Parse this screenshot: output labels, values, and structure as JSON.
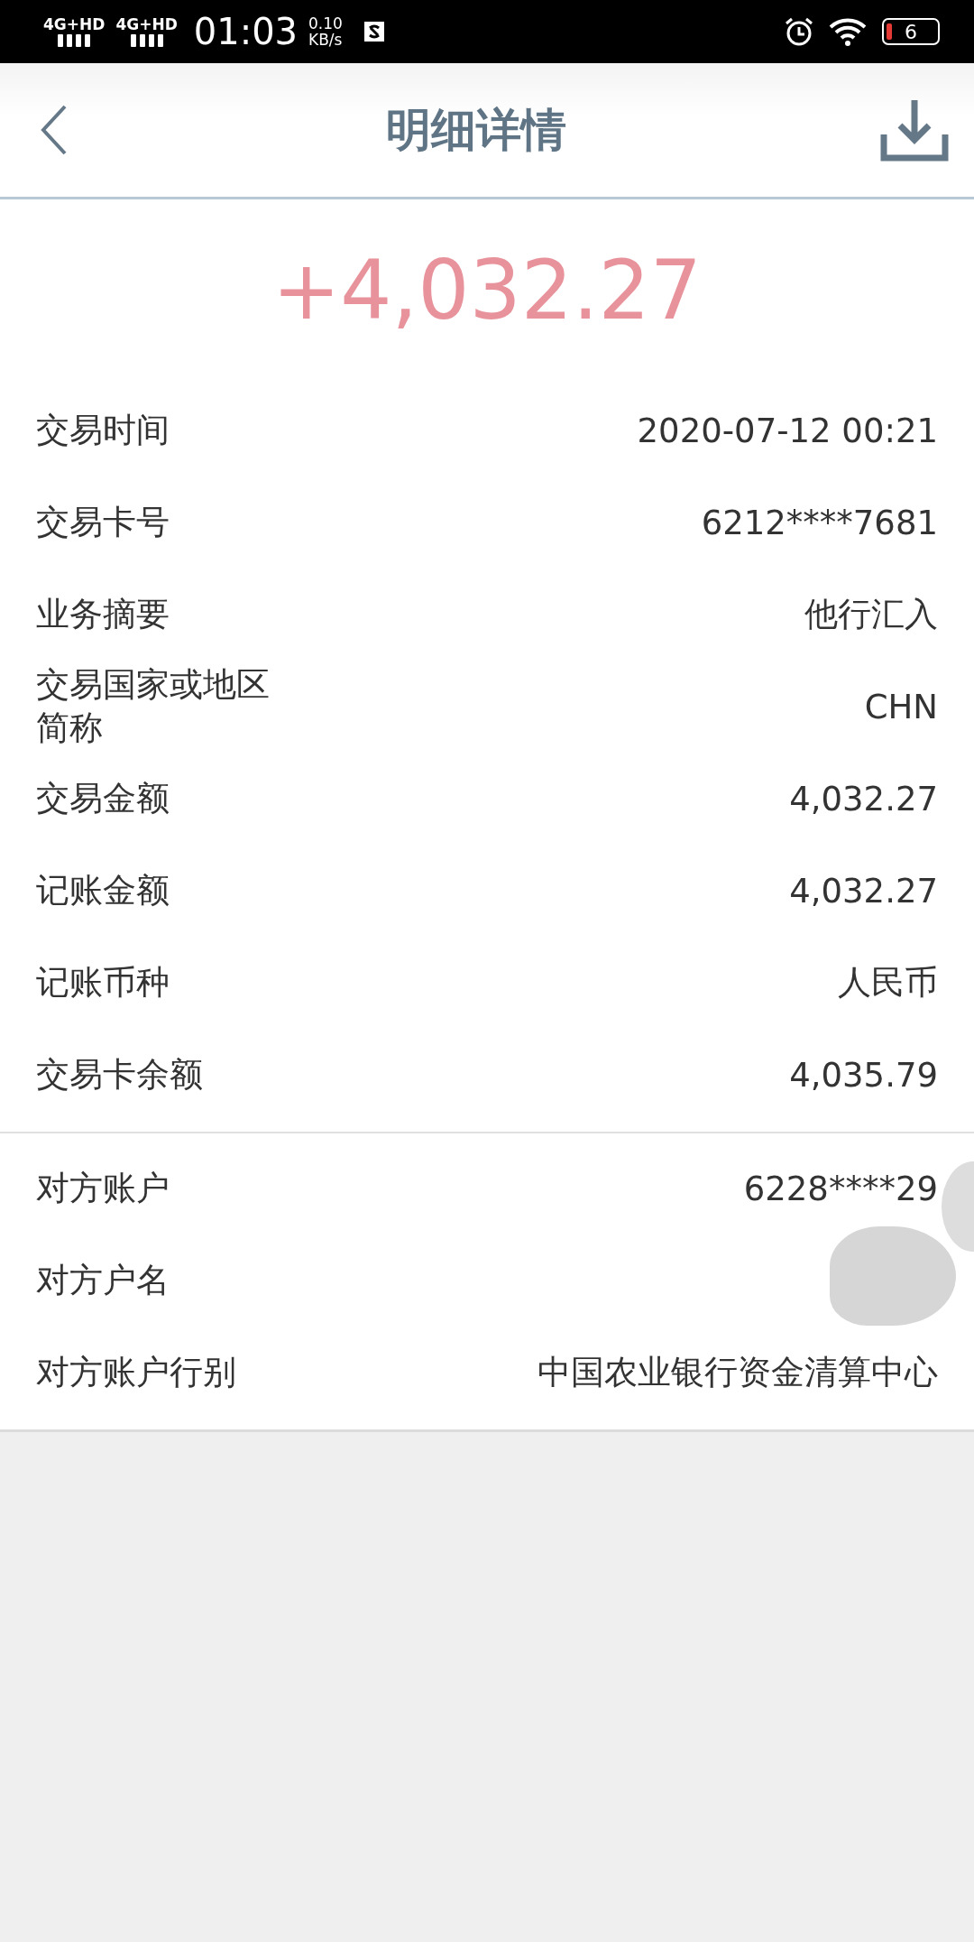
{
  "status_bar": {
    "signal_1": "4G+HD",
    "signal_2": "4G+HD",
    "time": "01:03",
    "speed_value": "0.10",
    "speed_unit": "KB/s",
    "battery": "6"
  },
  "header": {
    "title": "明细详情"
  },
  "amount": "+4,032.27",
  "details": [
    {
      "label": "交易时间",
      "value": "2020-07-12 00:21"
    },
    {
      "label": "交易卡号",
      "value": "6212****7681"
    },
    {
      "label": "业务摘要",
      "value": "他行汇入"
    },
    {
      "label": "交易国家或地区简称",
      "value": "CHN"
    },
    {
      "label": "交易金额",
      "value": "4,032.27"
    },
    {
      "label": "记账金额",
      "value": "4,032.27"
    },
    {
      "label": "记账币种",
      "value": "人民币"
    },
    {
      "label": "交易卡余额",
      "value": "4,035.79"
    }
  ],
  "counterparty": [
    {
      "label": "对方账户",
      "value": "6228****29"
    },
    {
      "label": "对方户名"
    },
    {
      "label": "对方账户行别",
      "value": "中国农业银行资金清算中心"
    }
  ]
}
